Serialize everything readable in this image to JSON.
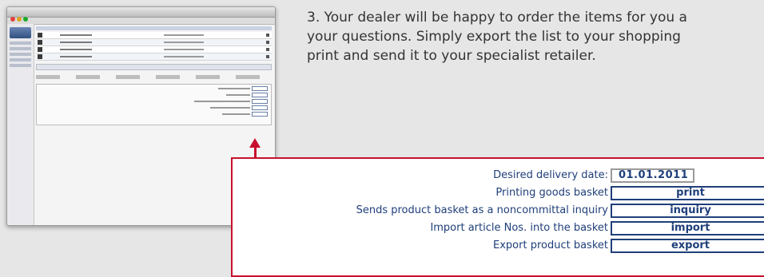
{
  "intro": {
    "line1": "3. Your dealer will be happy to order the items for you a",
    "line2": "your questions. Simply export the list to your shopping",
    "line3": "print and send it to your specialist retailer."
  },
  "callout": {
    "rows": [
      {
        "label": "Desired delivery date:",
        "value": "01.01.2011"
      },
      {
        "label": "Printing goods basket",
        "value": "print"
      },
      {
        "label": "Sends product basket as a noncommittal inquiry",
        "value": "inquiry"
      },
      {
        "label": "Import article Nos. into the basket",
        "value": "import"
      },
      {
        "label": "Export product basket",
        "value": "export"
      }
    ]
  },
  "colors": {
    "accent_red": "#c8102e",
    "text_blue": "#1f3f7a",
    "background": "#e6e6e6"
  },
  "icons": {
    "arrow": "arrow-up-icon",
    "window_controls": "traffic-light-icons"
  }
}
